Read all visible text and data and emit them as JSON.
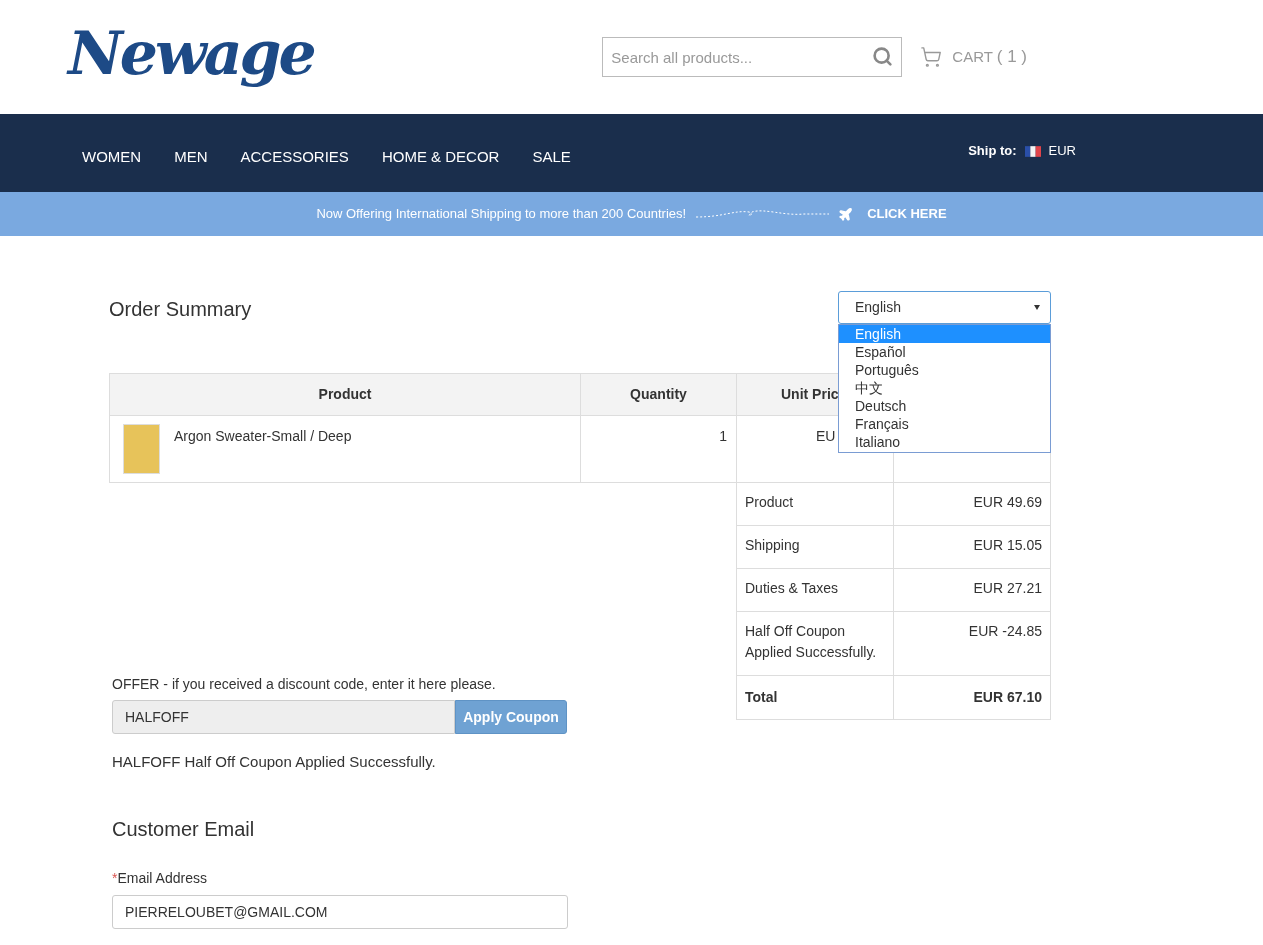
{
  "header": {
    "logo": "Newage",
    "search": {
      "placeholder": "Search all products..."
    },
    "cart": {
      "label": "CART",
      "count": "( 1 )"
    }
  },
  "nav": {
    "items": [
      {
        "label": "WOMEN"
      },
      {
        "label": "MEN"
      },
      {
        "label": "ACCESSORIES"
      },
      {
        "label": "HOME & DECOR"
      },
      {
        "label": "SALE"
      }
    ],
    "ship_to": {
      "label": "Ship to:",
      "currency": "EUR"
    }
  },
  "banner": {
    "text": "Now Offering International Shipping to more than 200 Countries!",
    "link": "CLICK HERE"
  },
  "order_summary": {
    "title": "Order Summary",
    "language_select": {
      "value": "English",
      "expanded": true,
      "options": [
        {
          "label": "English",
          "selected": true
        },
        {
          "label": "Español",
          "selected": false
        },
        {
          "label": "Português",
          "selected": false
        },
        {
          "label": "中文",
          "selected": false
        },
        {
          "label": "Deutsch",
          "selected": false
        },
        {
          "label": "Français",
          "selected": false
        },
        {
          "label": "Italiano",
          "selected": false
        }
      ]
    },
    "table": {
      "columns": [
        "Product",
        "Quantity",
        "Unit Pric"
      ],
      "rows": [
        {
          "product": "Argon Sweater-Small / Deep",
          "quantity": "1",
          "unit_price": "EU"
        }
      ]
    },
    "totals": [
      {
        "label": "Product",
        "value": "EUR 49.69",
        "bold": false
      },
      {
        "label": "Shipping",
        "value": "EUR 15.05",
        "bold": false
      },
      {
        "label": "Duties & Taxes",
        "value": "EUR 27.21",
        "bold": false
      },
      {
        "label": "Half Off Coupon Applied Successfully.",
        "value": "EUR -24.85",
        "bold": false
      },
      {
        "label": "Total",
        "value": "EUR 67.10",
        "bold": true
      }
    ]
  },
  "coupon": {
    "prompt": "OFFER - if you received a discount code, enter it here please.",
    "value": "HALFOFF",
    "button": "Apply Coupon",
    "message": "HALFOFF Half Off Coupon Applied Successfully."
  },
  "customer_email": {
    "title": "Customer Email",
    "required_mark": "*",
    "label": "Email Address",
    "value": "PIERRELOUBET@GMAIL.COM"
  }
}
